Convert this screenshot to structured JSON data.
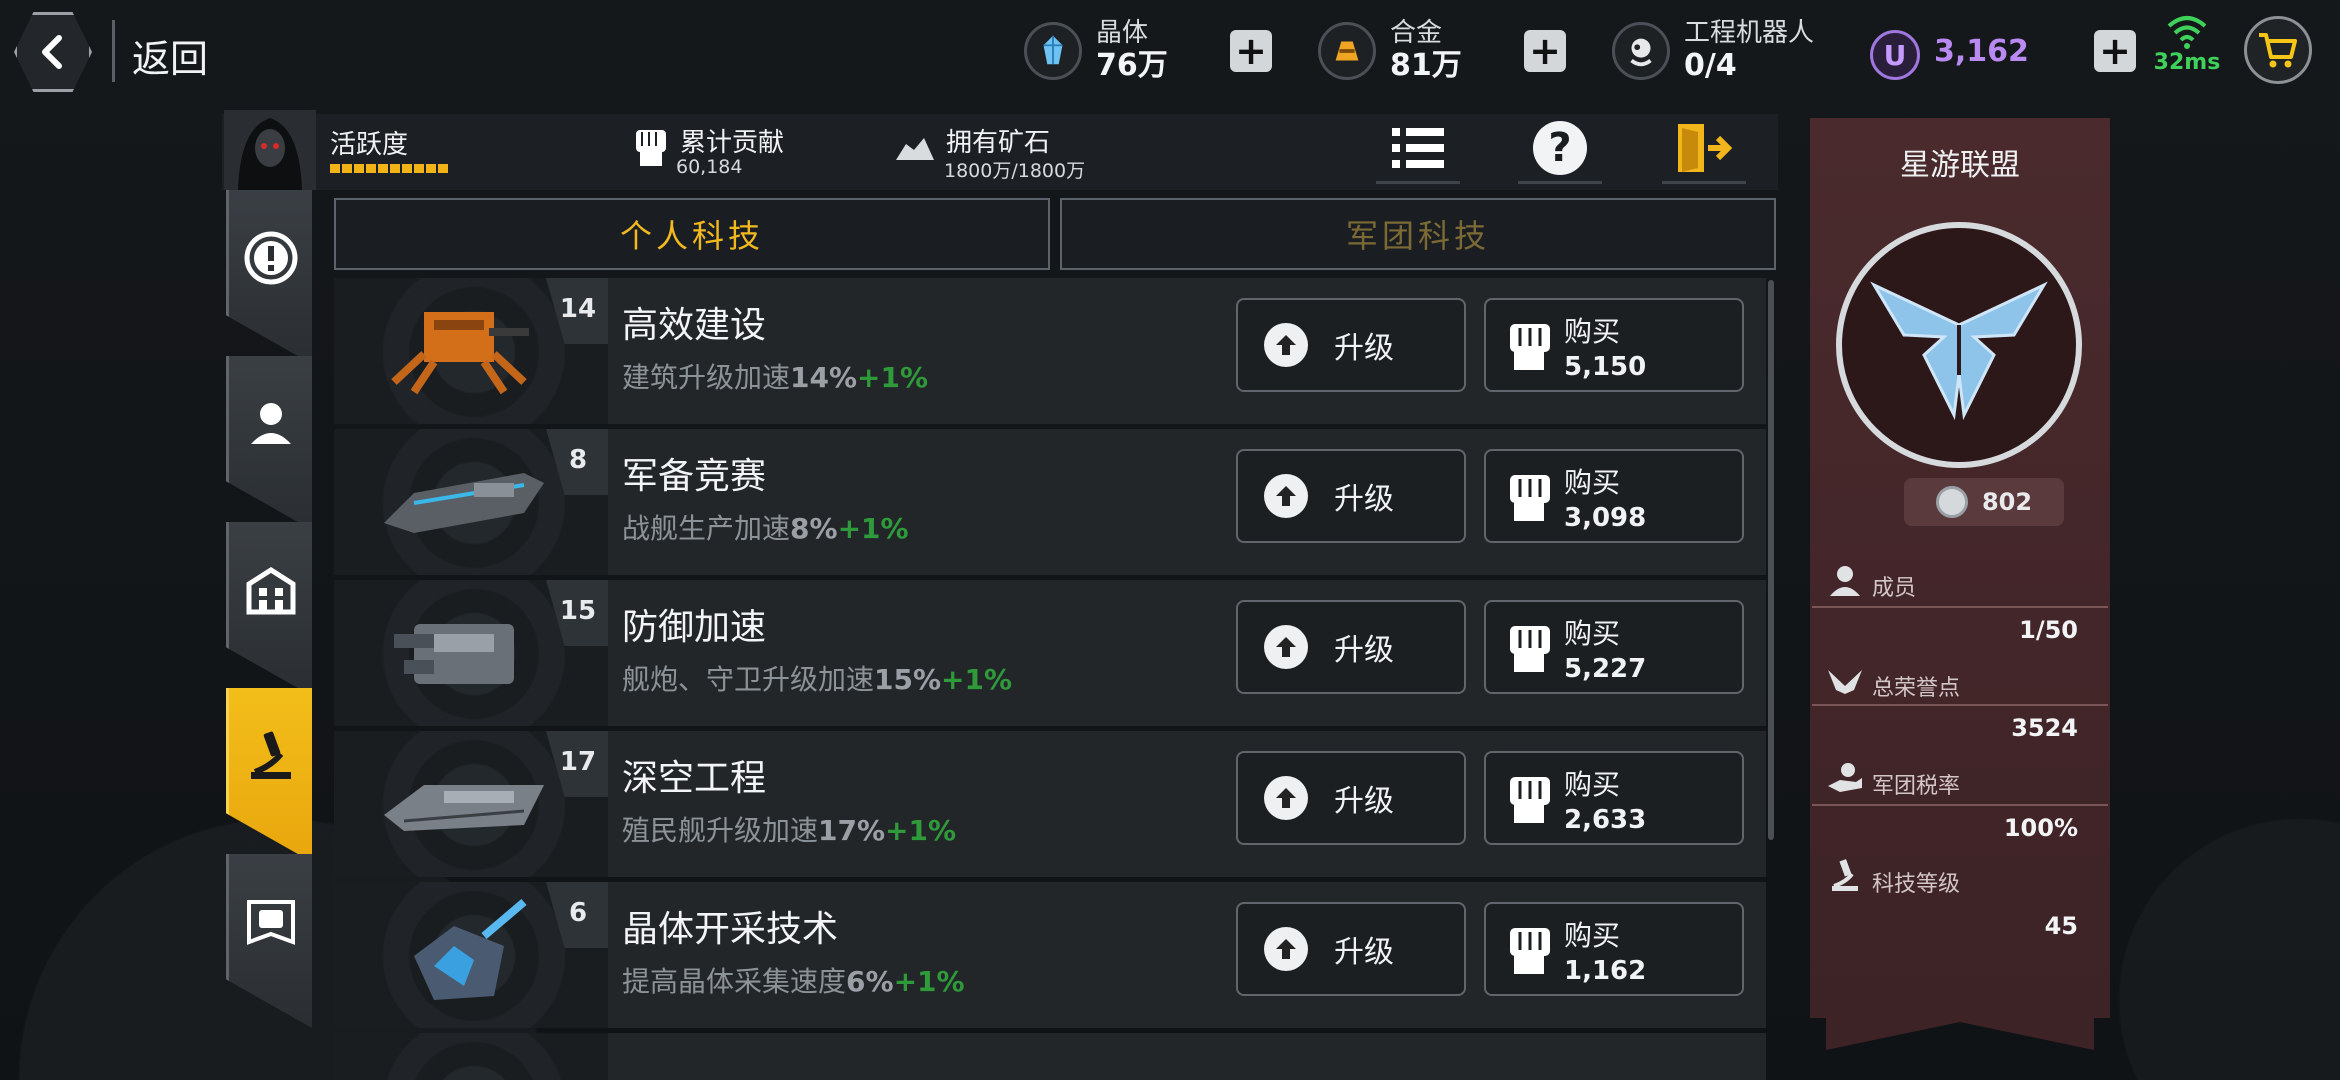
{
  "topbar": {
    "back_label": "返回",
    "resources": [
      {
        "name": "晶体",
        "value": "76万",
        "icon": "crystal-icon"
      },
      {
        "name": "合金",
        "value": "81万",
        "icon": "alloy-icon"
      },
      {
        "name": "工程机器人",
        "value": "0/4",
        "icon": "robot-icon"
      }
    ],
    "premium_value": "3,162",
    "premium_symbol": "U",
    "ping": "32ms"
  },
  "header": {
    "activity_label": "活跃度",
    "activity_segments": 10,
    "contribution_label": "累计贡献",
    "contribution_value": "60,184",
    "ore_label": "拥有矿石",
    "ore_value": "1800万/1800万",
    "help_glyph": "?"
  },
  "tabs": [
    {
      "label": "个人科技",
      "active": true
    },
    {
      "label": "军团科技",
      "active": false
    }
  ],
  "techs": [
    {
      "level": "14",
      "name": "高效建设",
      "desc": "建筑升级加速",
      "pct": "14%",
      "bonus": "+1%",
      "upgrade": "升级",
      "buy": "购买",
      "price": "5,150"
    },
    {
      "level": "8",
      "name": "军备竞赛",
      "desc": "战舰生产加速",
      "pct": "8%",
      "bonus": "+1%",
      "upgrade": "升级",
      "buy": "购买",
      "price": "3,098"
    },
    {
      "level": "15",
      "name": "防御加速",
      "desc": "舰炮、守卫升级加速",
      "pct": "15%",
      "bonus": "+1%",
      "upgrade": "升级",
      "buy": "购买",
      "price": "5,227"
    },
    {
      "level": "17",
      "name": "深空工程",
      "desc": "殖民舰升级加速",
      "pct": "17%",
      "bonus": "+1%",
      "upgrade": "升级",
      "buy": "购买",
      "price": "2,633"
    },
    {
      "level": "6",
      "name": "晶体开采技术",
      "desc": "提高晶体采集速度",
      "pct": "6%",
      "bonus": "+1%",
      "upgrade": "升级",
      "buy": "购买",
      "price": "1,162"
    }
  ],
  "alliance": {
    "name": "星游联盟",
    "score": "802",
    "stats": [
      {
        "label": "成员",
        "value": "1/50"
      },
      {
        "label": "总荣誉点",
        "value": "3524"
      },
      {
        "label": "军团税率",
        "value": "100%"
      },
      {
        "label": "科技等级",
        "value": "45"
      }
    ]
  },
  "colors": {
    "accent": "#f2b91f",
    "bonus": "#2f9a3a",
    "banner": "#4a2a2d",
    "premium": "#b98af2",
    "ping": "#3fd15a"
  }
}
